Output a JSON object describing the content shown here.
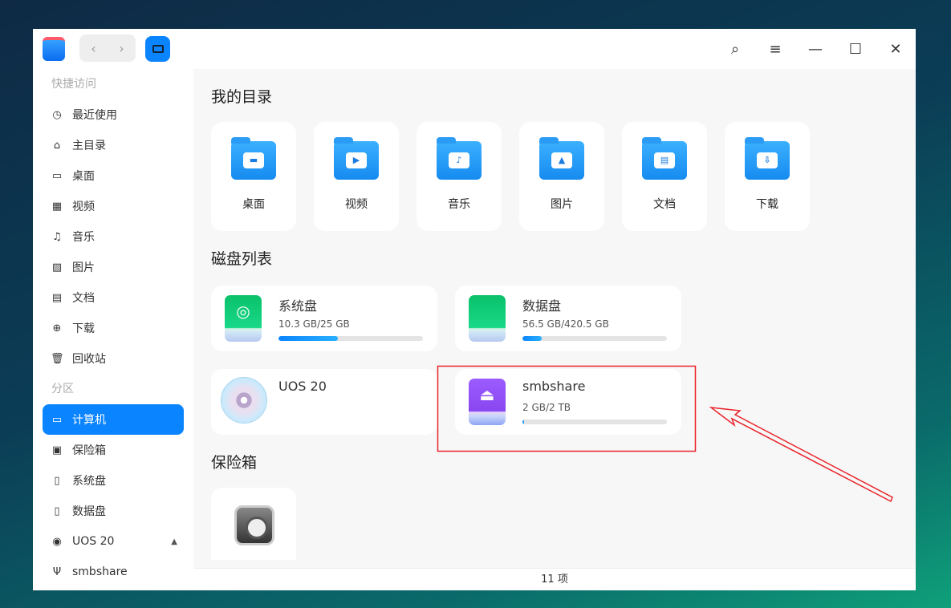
{
  "sidebar": {
    "quick_access": "快捷访问",
    "partitions": "分区",
    "quick": [
      {
        "label": "最近使用",
        "icon": "clock-icon"
      },
      {
        "label": "主目录",
        "icon": "home-icon"
      },
      {
        "label": "桌面",
        "icon": "desktop-icon"
      },
      {
        "label": "视频",
        "icon": "video-icon"
      },
      {
        "label": "音乐",
        "icon": "music-icon"
      },
      {
        "label": "图片",
        "icon": "picture-icon"
      },
      {
        "label": "文档",
        "icon": "document-icon"
      },
      {
        "label": "下载",
        "icon": "download-icon"
      },
      {
        "label": "回收站",
        "icon": "trash-icon"
      }
    ],
    "parts": [
      {
        "label": "计算机",
        "icon": "computer-icon"
      },
      {
        "label": "保险箱",
        "icon": "vault-icon"
      },
      {
        "label": "系统盘",
        "icon": "disk-icon"
      },
      {
        "label": "数据盘",
        "icon": "disk-icon"
      },
      {
        "label": "UOS 20",
        "icon": "cd-icon"
      },
      {
        "label": "smbshare",
        "icon": "usb-icon"
      }
    ]
  },
  "main": {
    "my_dirs": "我的目录",
    "disk_list": "磁盘列表",
    "vault": "保险箱",
    "dirs": [
      "桌面",
      "视频",
      "音乐",
      "图片",
      "文档",
      "下载"
    ],
    "disks": [
      {
        "name": "系统盘",
        "size": "10.3 GB/25 GB",
        "usage": 0.41
      },
      {
        "name": "数据盘",
        "size": "56.5 GB/420.5 GB",
        "usage": 0.134
      },
      {
        "name": "UOS 20",
        "size": ""
      },
      {
        "name": "smbshare",
        "size": "2 GB/2 TB",
        "usage": 0.001
      }
    ]
  },
  "status": {
    "count": "11 项"
  },
  "annotation": {
    "color": "#e8232a"
  }
}
